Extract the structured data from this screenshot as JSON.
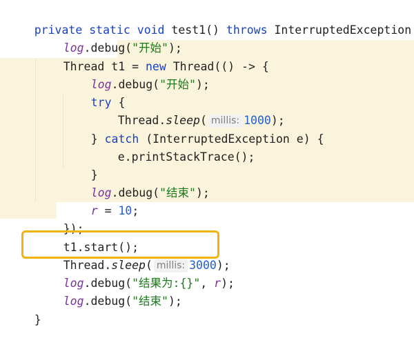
{
  "code": {
    "l1": {
      "a": "private static void",
      "b": " test1() ",
      "c": "throws",
      "d": " InterruptedException {"
    },
    "l2": {
      "a": "log",
      "b": ".debug(",
      "c": "\"开始\"",
      "d": ");"
    },
    "l3": {
      "a": "Thread t1 = ",
      "b": "new",
      "c": " Thread(() -> {"
    },
    "l4": {
      "a": "log",
      "b": ".debug(",
      "c": "\"开始\"",
      "d": ");"
    },
    "l5": {
      "a": "try",
      "b": " {"
    },
    "l6": {
      "a": "Thread.",
      "b": "sleep",
      "c": "(",
      "hint": "millis:",
      "num": "1000",
      "d": ");"
    },
    "l7": {
      "a": "} ",
      "b": "catch",
      "c": " (InterruptedException e) {"
    },
    "l8": {
      "a": "e.printStackTrace();"
    },
    "l9": {
      "a": "}"
    },
    "l10": {
      "a": "log",
      "b": ".debug(",
      "c": "\"结束\"",
      "d": ");"
    },
    "l11": {
      "a": "r",
      "b": " = ",
      "num": "10",
      "d": ";"
    },
    "l12": {
      "a": "});"
    },
    "l13": {
      "a": "t1.start();"
    },
    "l14": {
      "a": "Thread.",
      "b": "sleep",
      "c": "(",
      "hint": "millis:",
      "num": "3000",
      "d": ");"
    },
    "l15": {
      "a": "log",
      "b": ".debug(",
      "c": "\"结果为:{}\"",
      "d": ", ",
      "e": "r",
      "f": ");"
    },
    "l16": {
      "a": "log",
      "b": ".debug(",
      "c": "\"结束\"",
      "d": ");"
    },
    "l17": {
      "a": "}"
    }
  },
  "colors": {
    "keyword": "#1640c8",
    "field": "#7a2fa0",
    "string": "#1a7a1a",
    "number": "#1f5fd1",
    "highlight": "#fbf4dc",
    "focus_box": "#f2b40a"
  }
}
